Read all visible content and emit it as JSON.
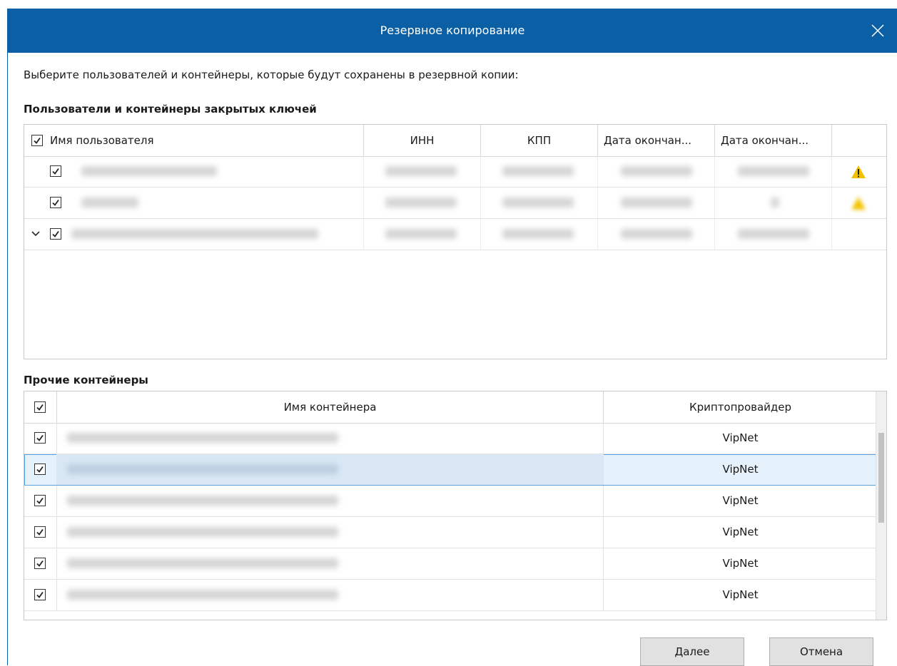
{
  "window": {
    "title": "Резервное копирование"
  },
  "prompt": "Выберите пользователей и контейнеры, которые будут сохранены в резервной копии:",
  "users_section": {
    "title": "Пользователи и контейнеры закрытых ключей",
    "columns": [
      "Имя пользователя",
      "ИНН",
      "КПП",
      "Дата окончан...",
      "Дата окончан..."
    ],
    "rows": [
      {
        "checked": true,
        "expandable": false,
        "warning": true
      },
      {
        "checked": true,
        "expandable": false,
        "warning": true
      },
      {
        "checked": true,
        "expandable": true,
        "warning": false
      }
    ]
  },
  "containers_section": {
    "title": "Прочие контейнеры",
    "columns": [
      "Имя контейнера",
      "Криптопровайдер"
    ],
    "rows": [
      {
        "checked": true,
        "provider": "VipNet",
        "selected": false
      },
      {
        "checked": true,
        "provider": "VipNet",
        "selected": true
      },
      {
        "checked": true,
        "provider": "VipNet",
        "selected": false
      },
      {
        "checked": true,
        "provider": "VipNet",
        "selected": false
      },
      {
        "checked": true,
        "provider": "VipNet",
        "selected": false
      },
      {
        "checked": true,
        "provider": "VipNet",
        "selected": false
      }
    ]
  },
  "buttons": {
    "next": "Далее",
    "cancel": "Отмена"
  },
  "colors": {
    "titlebar": "#0b5fa5",
    "warning": "#f2c200",
    "selection": "#e5f1fb"
  }
}
